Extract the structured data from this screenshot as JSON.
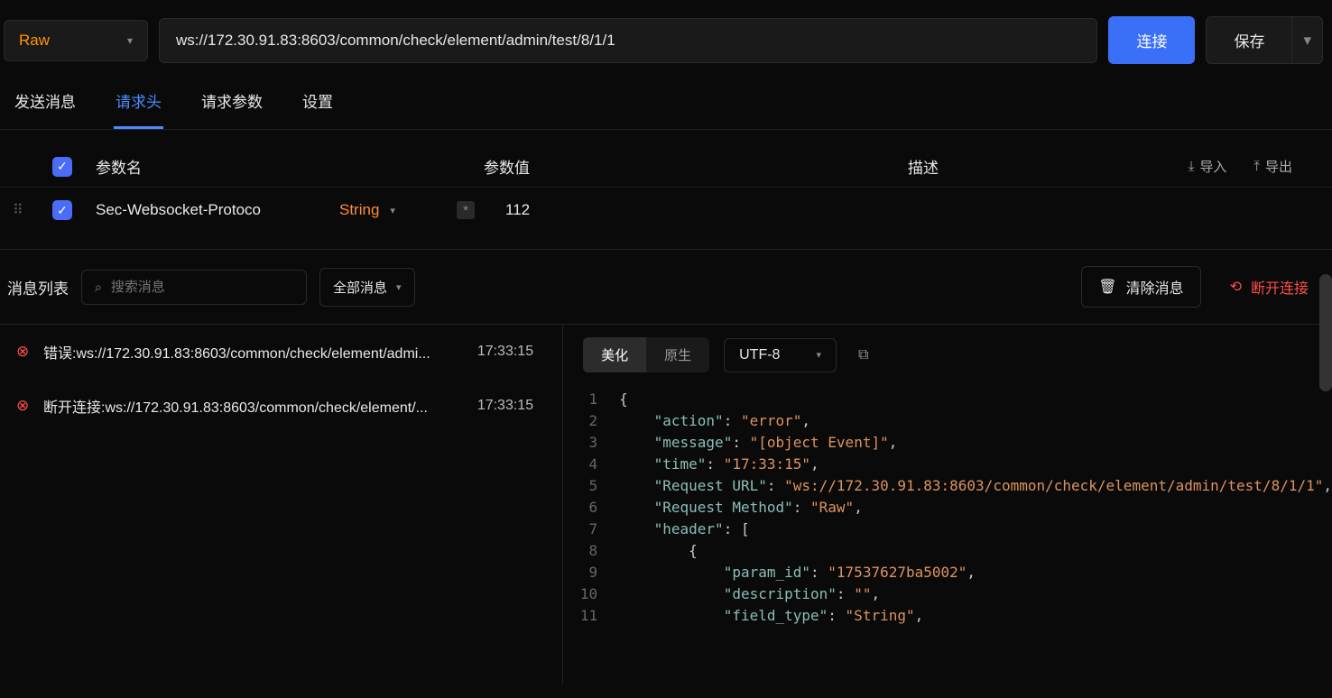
{
  "topbar": {
    "method": "Raw",
    "url": "ws://172.30.91.83:8603/common/check/element/admin/test/8/1/1",
    "connect": "连接",
    "save": "保存"
  },
  "tabs": {
    "send": "发送消息",
    "headers": "请求头",
    "params": "请求参数",
    "settings": "设置"
  },
  "headers_table": {
    "col_name": "参数名",
    "col_value": "参数值",
    "col_desc": "描述",
    "import": "导入",
    "export": "导出",
    "rows": [
      {
        "name": "Sec-Websocket-Protoco",
        "type": "String",
        "value": "112"
      }
    ]
  },
  "msg_toolbar": {
    "title": "消息列表",
    "search_placeholder": "搜索消息",
    "filter": "全部消息",
    "clear": "清除消息",
    "disconnect": "断开连接"
  },
  "messages": [
    {
      "text": "错误:ws://172.30.91.83:8603/common/check/element/admi...",
      "time": "17:33:15"
    },
    {
      "text": "断开连接:ws://172.30.91.83:8603/common/check/element/...",
      "time": "17:33:15"
    }
  ],
  "detail": {
    "beautify": "美化",
    "raw": "原生",
    "encoding": "UTF-8",
    "json_lines": [
      {
        "n": 1,
        "tokens": [
          [
            "punc",
            "{"
          ]
        ]
      },
      {
        "n": 2,
        "tokens": [
          [
            "indent",
            "    "
          ],
          [
            "key",
            "\"action\""
          ],
          [
            "col",
            ": "
          ],
          [
            "str",
            "\"error\""
          ],
          [
            "punc",
            ","
          ]
        ]
      },
      {
        "n": 3,
        "tokens": [
          [
            "indent",
            "    "
          ],
          [
            "key",
            "\"message\""
          ],
          [
            "col",
            ": "
          ],
          [
            "str",
            "\"[object Event]\""
          ],
          [
            "punc",
            ","
          ]
        ]
      },
      {
        "n": 4,
        "tokens": [
          [
            "indent",
            "    "
          ],
          [
            "key",
            "\"time\""
          ],
          [
            "col",
            ": "
          ],
          [
            "str",
            "\"17:33:15\""
          ],
          [
            "punc",
            ","
          ]
        ]
      },
      {
        "n": 5,
        "tokens": [
          [
            "indent",
            "    "
          ],
          [
            "key",
            "\"Request URL\""
          ],
          [
            "col",
            ": "
          ],
          [
            "str",
            "\"ws://172.30.91.83:8603/common/check/element/admin/test/8/1/1\""
          ],
          [
            "punc",
            ","
          ]
        ]
      },
      {
        "n": 6,
        "tokens": [
          [
            "indent",
            "    "
          ],
          [
            "key",
            "\"Request Method\""
          ],
          [
            "col",
            ": "
          ],
          [
            "str",
            "\"Raw\""
          ],
          [
            "punc",
            ","
          ]
        ]
      },
      {
        "n": 7,
        "tokens": [
          [
            "indent",
            "    "
          ],
          [
            "key",
            "\"header\""
          ],
          [
            "col",
            ": "
          ],
          [
            "punc",
            "["
          ]
        ]
      },
      {
        "n": 8,
        "tokens": [
          [
            "indent",
            "        "
          ],
          [
            "punc",
            "{"
          ]
        ]
      },
      {
        "n": 9,
        "tokens": [
          [
            "indent",
            "            "
          ],
          [
            "key",
            "\"param_id\""
          ],
          [
            "col",
            ": "
          ],
          [
            "str",
            "\"17537627ba5002\""
          ],
          [
            "punc",
            ","
          ]
        ]
      },
      {
        "n": 10,
        "tokens": [
          [
            "indent",
            "            "
          ],
          [
            "key",
            "\"description\""
          ],
          [
            "col",
            ": "
          ],
          [
            "str",
            "\"\""
          ],
          [
            "punc",
            ","
          ]
        ]
      },
      {
        "n": 11,
        "tokens": [
          [
            "indent",
            "            "
          ],
          [
            "key",
            "\"field_type\""
          ],
          [
            "col",
            ": "
          ],
          [
            "str",
            "\"String\""
          ],
          [
            "punc",
            ","
          ]
        ]
      }
    ]
  }
}
